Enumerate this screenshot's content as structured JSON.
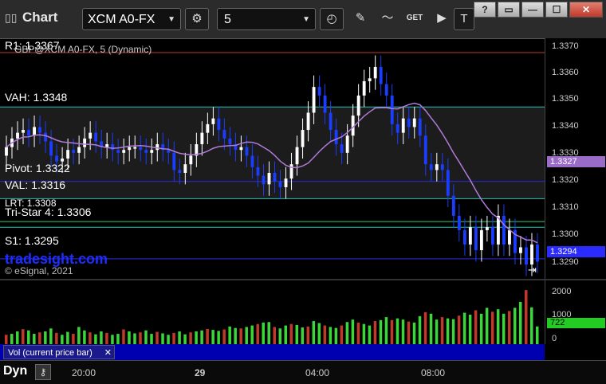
{
  "app": {
    "title": "Chart"
  },
  "toolbar": {
    "symbol": "XCM A0-FX",
    "interval": "5",
    "get_label": "GET"
  },
  "window_controls": {
    "help": "?",
    "restore": "▭",
    "minimize": "—",
    "maximize": "☐",
    "close": "✕"
  },
  "chart_header": {
    "study_line": "GBP@XCM A0-FX, 5 (Dynamic)",
    "r1_label": "R1: 1.3367"
  },
  "levels": {
    "vah": "VAH: 1.3348",
    "pivot": "Pivot: 1.3322",
    "val": "VAL: 1.3316",
    "lrt": "LRT: 1.3308",
    "tristar": "Tri-Star 4: 1.3306",
    "s1": "S1: 1.3295"
  },
  "price_axis": {
    "ticks": [
      "1.3370",
      "1.3360",
      "1.3350",
      "1.3340",
      "1.3330",
      "1.3320",
      "1.3310",
      "1.3300",
      "1.3290"
    ],
    "ma_value": "1.3327",
    "last_price": "1.3294"
  },
  "volume_axis": {
    "ticks": [
      "2000",
      "1000",
      "0"
    ],
    "last_volume": "722"
  },
  "time_axis": {
    "ticks": [
      "20:00",
      "29",
      "04:00",
      "08:00"
    ]
  },
  "footer": {
    "watermark": "tradesight.com",
    "copyright": "© eSignal, 2021",
    "volume_label": "Vol (current price bar)",
    "dynamic_label": "Dyn"
  },
  "colors": {
    "up_bar": "#ffffff",
    "down_bar": "#1a3dff",
    "ma_line": "#b07ad8",
    "level_line": "#2ec4b6",
    "pivot_line": "#2a2ae0",
    "r1_line": "#c0392b",
    "countdown_digits": "#2bd12b",
    "volume_up": "#3ad63a",
    "volume_down": "#c0392b",
    "last_price_bg": "#2b2bff",
    "ma_badge_bg": "#9a6cc8",
    "volume_badge_bg": "#22cc22"
  },
  "chart_data": {
    "type": "candlestick",
    "series": [
      {
        "values": [
          1.3334,
          1.3337,
          1.3339,
          1.334,
          1.3338,
          1.3341,
          1.3339,
          1.3336,
          1.3331,
          1.3329,
          1.333,
          1.3333,
          1.3332,
          1.3334,
          1.3337,
          1.3339,
          1.3336,
          1.3334,
          1.3335,
          1.3333,
          1.3332,
          1.3333,
          1.3334,
          1.3334,
          1.3333,
          1.3332,
          1.3333,
          1.3335,
          1.3333,
          1.3332,
          1.3326,
          1.3325,
          1.3328,
          1.3331,
          1.3335,
          1.3339,
          1.3342,
          1.3344,
          1.334,
          1.3337,
          1.3335,
          1.3333,
          1.3334,
          1.3331,
          1.3327,
          1.3324,
          1.3321,
          1.3325,
          1.3322,
          1.332,
          1.3323,
          1.3328,
          1.3334,
          1.334,
          1.3346,
          1.3355,
          1.3352,
          1.3346,
          1.334,
          1.3335,
          1.3332,
          1.3338,
          1.3345,
          1.3352,
          1.3357,
          1.3358,
          1.3362,
          1.3356,
          1.3352,
          1.3342,
          1.3339,
          1.3344,
          1.3341,
          1.3344,
          1.3338,
          1.3328,
          1.3326,
          1.3328,
          1.3326,
          1.3317,
          1.331,
          1.3305,
          1.33,
          1.3306,
          1.3298,
          1.3305,
          1.3306,
          1.33,
          1.331,
          1.33,
          1.3305,
          1.3297,
          1.3299,
          1.3293,
          1.33,
          1.3294
        ]
      }
    ],
    "ylim": [
      1.3288,
      1.3372
    ],
    "levels": {
      "R1": 1.3367,
      "VAH": 1.3348,
      "Pivot": 1.3322,
      "VAL": 1.3316,
      "LRT": 1.3308,
      "Tri-Star 4": 1.3306,
      "S1": 1.3295
    },
    "volume": [
      380,
      420,
      520,
      610,
      560,
      420,
      480,
      520,
      640,
      460,
      380,
      500,
      420,
      700,
      560,
      480,
      400,
      520,
      460,
      380,
      420,
      600,
      520,
      440,
      480,
      560,
      420,
      500,
      440,
      380,
      460,
      520,
      400,
      480,
      520,
      560,
      620,
      580,
      540,
      600,
      720,
      660,
      640,
      700,
      760,
      820,
      880,
      900,
      700,
      640,
      760,
      820,
      780,
      680,
      720,
      940,
      860,
      760,
      700,
      660,
      760,
      900,
      1000,
      880,
      820,
      760,
      940,
      980,
      1100,
      980,
      1050,
      1000,
      920,
      880,
      1140,
      1300,
      1240,
      1000,
      1100,
      1050,
      1020,
      1160,
      1280,
      1200,
      1380,
      1240,
      1480,
      1320,
      1420,
      1240,
      1350,
      1480,
      1720,
      2200,
      1500,
      722
    ]
  }
}
